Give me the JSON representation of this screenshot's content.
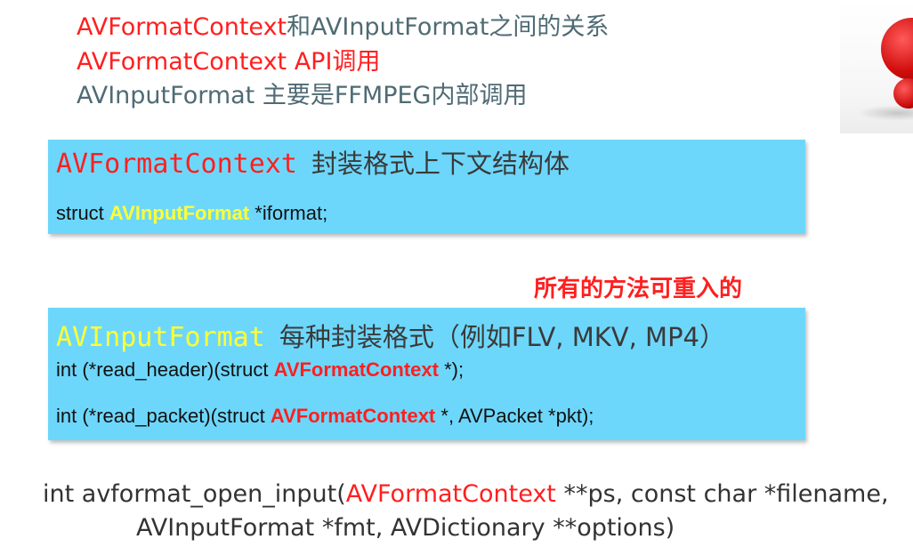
{
  "bullets": [
    {
      "red": "AVFormatContext",
      "rest": "和AVInputFormat之间的关系"
    },
    {
      "red": "AVFormatContext API调用",
      "rest": ""
    },
    {
      "red": "",
      "rest": "AVInputFormat 主要是FFMPEG内部调用"
    }
  ],
  "box1": {
    "title_code": "AVFormatContext",
    "title_cn": "封装格式上下文结构体",
    "line1": {
      "pre": "struct ",
      "highlight": "AVInputFormat",
      "post": " *iformat;"
    }
  },
  "note": "所有的方法可重入的",
  "box2": {
    "title_code": "AVInputFormat",
    "title_cn": "每种封装格式（例如FLV, MKV, MP4）",
    "line1": {
      "pre": "int (*read_header)(struct ",
      "highlight": "AVFormatContext",
      "post": " *);"
    },
    "line2": {
      "pre": "int (*read_packet)(struct ",
      "highlight": "AVFormatContext",
      "post": " *, AVPacket *pkt);"
    }
  },
  "signature": {
    "line1_pre": "int avformat_open_input(",
    "line1_red": "AVFormatContext",
    "line1_post": " **ps, const char *filename,",
    "line2": "AVInputFormat *fmt, AVDictionary **options)"
  },
  "colors": {
    "accent_red": "#ff1f1f",
    "box_blue": "#6dd7fb",
    "highlight_yellow": "#ffff33",
    "bullet_gray": "#4f6b74"
  }
}
